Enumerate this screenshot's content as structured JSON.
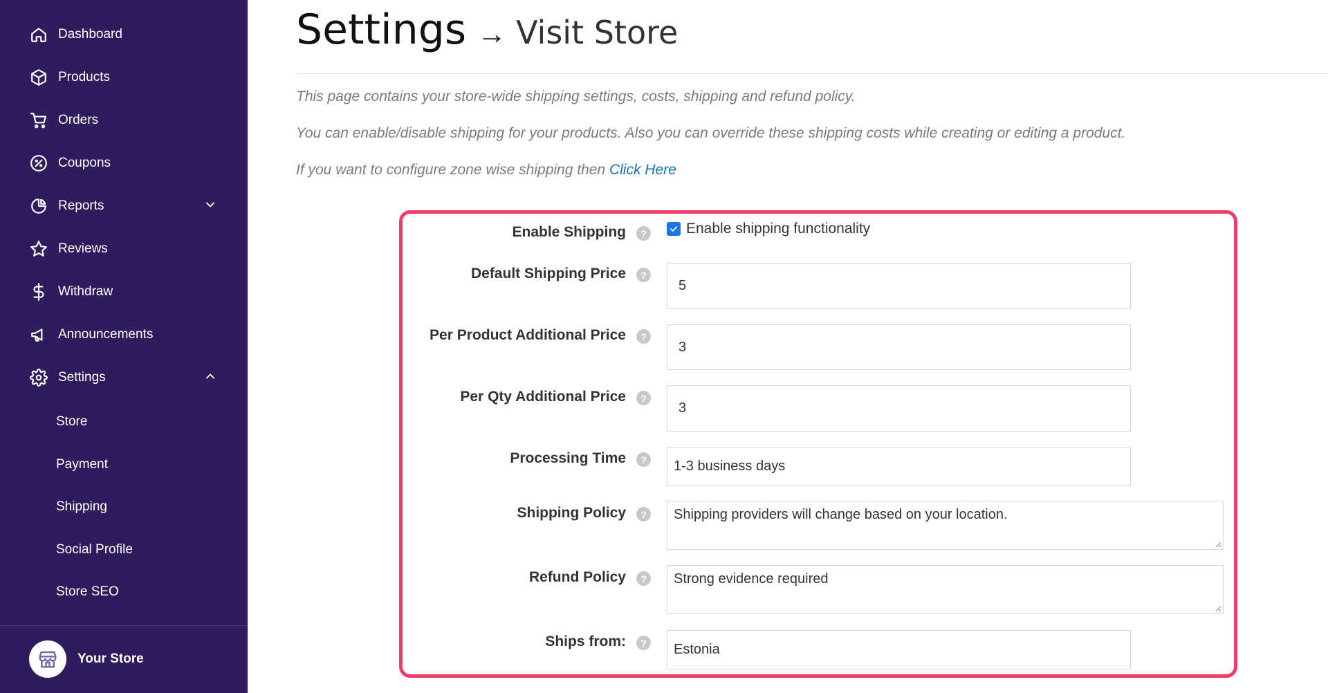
{
  "sidebar": {
    "items": [
      {
        "label": "Dashboard",
        "icon": "home-icon"
      },
      {
        "label": "Products",
        "icon": "box-icon"
      },
      {
        "label": "Orders",
        "icon": "cart-icon"
      },
      {
        "label": "Coupons",
        "icon": "coupon-icon"
      },
      {
        "label": "Reports",
        "icon": "pie-chart-icon"
      },
      {
        "label": "Reviews",
        "icon": "star-icon"
      },
      {
        "label": "Withdraw",
        "icon": "dollar-icon"
      },
      {
        "label": "Announcements",
        "icon": "megaphone-icon"
      },
      {
        "label": "Settings",
        "icon": "gear-icon"
      }
    ],
    "sub_items": [
      "Store",
      "Payment",
      "Shipping",
      "Social Profile",
      "Store SEO"
    ],
    "store_name": "Your Store"
  },
  "header": {
    "title": "Settings",
    "arrow": "→",
    "link": "Visit Store"
  },
  "description": {
    "line1": "This page contains your store-wide shipping settings, costs, shipping and refund policy.",
    "line2": "You can enable/disable shipping for your products. Also you can override these shipping costs while creating or editing a product.",
    "line3": "If you want to configure zone wise shipping then",
    "line3_link": "Click Here"
  },
  "form": {
    "enable_shipping": {
      "label": "Enable Shipping",
      "checkbox_label": "Enable shipping functionality",
      "checked": true
    },
    "default_price": {
      "label": "Default Shipping Price",
      "value": "5"
    },
    "per_product": {
      "label": "Per Product Additional Price",
      "value": "3"
    },
    "per_qty": {
      "label": "Per Qty Additional Price",
      "value": "3"
    },
    "processing_time": {
      "label": "Processing Time",
      "value": "1-3 business days"
    },
    "shipping_policy": {
      "label": "Shipping Policy",
      "value": "Shipping providers will change based on your location."
    },
    "refund_policy": {
      "label": "Refund Policy",
      "value": "Strong evidence required"
    },
    "ships_from": {
      "label": "Ships from:",
      "value": "Estonia"
    },
    "help_glyph": "?"
  },
  "colors": {
    "sidebar_bg": "#2f1c5e",
    "highlight_border": "#ef3d6b",
    "link": "#1a6fb8",
    "checkbox": "#1e74e6"
  }
}
